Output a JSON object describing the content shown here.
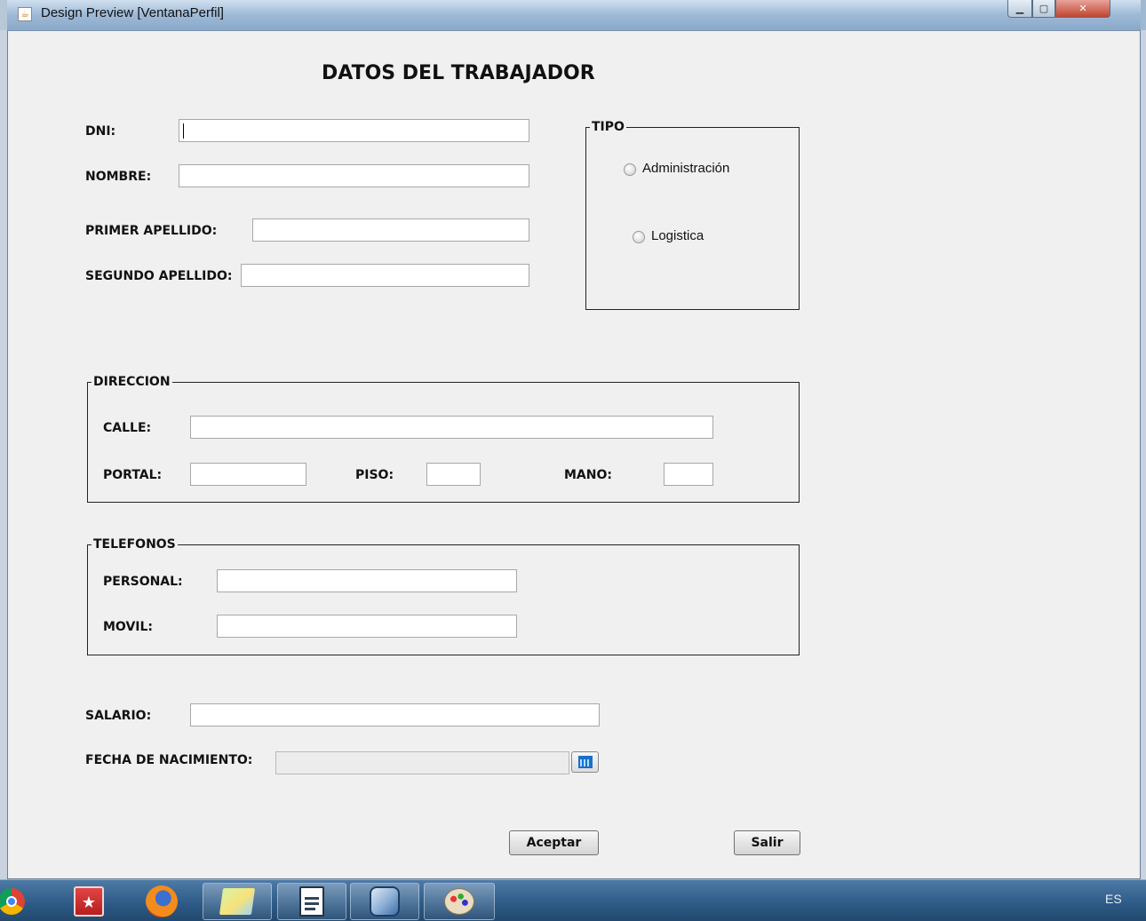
{
  "window": {
    "title": "Design Preview [VentanaPerfil]"
  },
  "form": {
    "heading": "DATOS DEL TRABAJADOR",
    "dni_label": "DNI:",
    "dni_value": "",
    "nombre_label": "NOMBRE:",
    "nombre_value": "",
    "primer_apellido_label": "PRIMER APELLIDO:",
    "primer_apellido_value": "",
    "segundo_apellido_label": "SEGUNDO APELLIDO:",
    "segundo_apellido_value": ""
  },
  "tipo": {
    "legend": "TIPO",
    "options": [
      {
        "label": "Administración",
        "selected": false
      },
      {
        "label": "Logistica",
        "selected": false
      }
    ]
  },
  "direccion": {
    "legend": "DIRECCION",
    "calle_label": "CALLE:",
    "calle_value": "",
    "portal_label": "PORTAL:",
    "portal_value": "",
    "piso_label": "PISO:",
    "piso_value": "",
    "mano_label": "MANO:",
    "mano_value": ""
  },
  "telefonos": {
    "legend": "TELEFONOS",
    "personal_label": "PERSONAL:",
    "personal_value": "",
    "movil_label": "MOVIL:",
    "movil_value": ""
  },
  "salario": {
    "label": "SALARIO:",
    "value": ""
  },
  "fecha": {
    "label": "FECHA DE NACIMIENTO:",
    "value": "",
    "picker_icon": "calendar-icon"
  },
  "buttons": {
    "aceptar": "Aceptar",
    "salir": "Salir"
  },
  "taskbar": {
    "items": [
      "chrome-icon",
      "bookmark-app-icon",
      "firefox-icon",
      "sticky-notes-icon",
      "document-icon",
      "virtualbox-icon",
      "paint-icon"
    ],
    "language": "ES"
  }
}
